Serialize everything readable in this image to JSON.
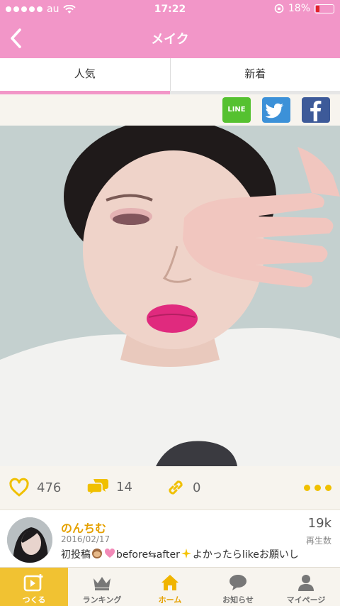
{
  "status": {
    "carrier": "au",
    "time": "17:22",
    "battery": "18%"
  },
  "header": {
    "title": "メイク"
  },
  "tabs": [
    {
      "label": "人気",
      "active": true
    },
    {
      "label": "新着",
      "active": false
    }
  ],
  "share": {
    "line_label": "LINE"
  },
  "stats": {
    "likes": "476",
    "comments": "14",
    "links": "0"
  },
  "post": {
    "username": "のんちむ",
    "date": "2016/02/17",
    "play_count": "19k",
    "play_label": "再生数",
    "caption": "初投稿",
    "caption_2": "before⇆after",
    "caption_3": "よかったらlikeお願いし"
  },
  "tabbar": [
    {
      "label": "つくる"
    },
    {
      "label": "ランキング"
    },
    {
      "label": "ホーム"
    },
    {
      "label": "お知らせ"
    },
    {
      "label": "マイページ"
    }
  ],
  "colors": {
    "brand_pink": "#f296c8",
    "accent_yellow": "#f1c232",
    "accent_text_yellow": "#e5a100"
  }
}
